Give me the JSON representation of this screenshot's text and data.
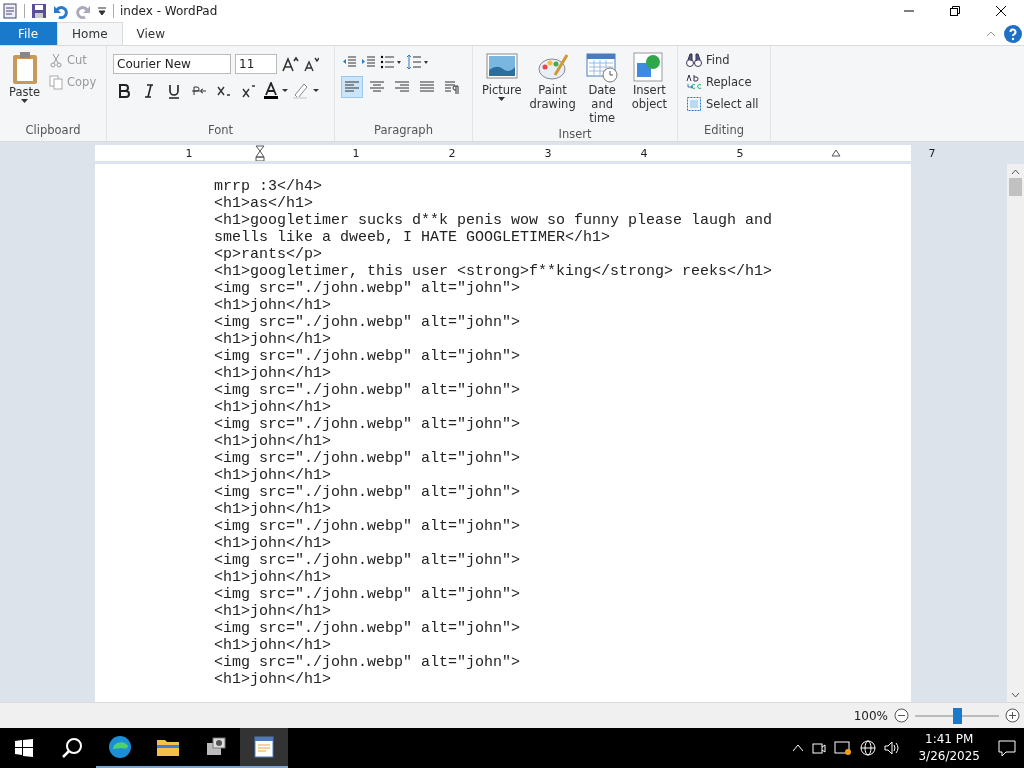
{
  "window": {
    "title": "index - WordPad"
  },
  "tabs": [
    {
      "label": "File",
      "kind": "file",
      "selected": false
    },
    {
      "label": "Home",
      "kind": "tab",
      "selected": true
    },
    {
      "label": "View",
      "kind": "tab",
      "selected": false
    }
  ],
  "ribbon": {
    "clipboard": {
      "label": "Clipboard",
      "paste": "Paste",
      "cut": {
        "label": "Cut",
        "disabled": true
      },
      "copy": {
        "label": "Copy",
        "disabled": true
      }
    },
    "font": {
      "label": "Font",
      "family": "Courier New",
      "size": "11"
    },
    "paragraph": {
      "label": "Paragraph"
    },
    "insert": {
      "label": "Insert",
      "buttons": [
        {
          "label": "Picture",
          "kind": "picture",
          "dropdown": true
        },
        {
          "label": "Paint drawing",
          "kind": "paint",
          "dropdown": false
        },
        {
          "label": "Date and time",
          "kind": "date",
          "dropdown": false
        },
        {
          "label": "Insert object",
          "kind": "object",
          "dropdown": false
        }
      ]
    },
    "editing": {
      "label": "Editing",
      "buttons": [
        {
          "label": "Find",
          "kind": "find"
        },
        {
          "label": "Replace",
          "kind": "replace"
        },
        {
          "label": "Select all",
          "kind": "selectall"
        }
      ]
    }
  },
  "ruler": [
    {
      "kind": "number",
      "text": "1"
    },
    {
      "kind": "indent"
    },
    {
      "kind": "number",
      "text": "1"
    },
    {
      "kind": "number",
      "text": "2"
    },
    {
      "kind": "number",
      "text": "3"
    },
    {
      "kind": "number",
      "text": "4"
    },
    {
      "kind": "number",
      "text": "5"
    },
    {
      "kind": "margin"
    },
    {
      "kind": "number",
      "text": "7"
    }
  ],
  "document": {
    "lines": [
      "mrrp :3</h4>",
      "<h1>as</h1>",
      "<h1>googletimer sucks d**k penis wow so funny please laugh and",
      "smells like a dweeb, I HATE GOOGLETIMER</h1>",
      "<p>rants</p>",
      "<h1>googletimer, this user <strong>f**king</strong> reeks</h1>",
      "<img src=\"./john.webp\" alt=\"john\">",
      "<h1>john</h1>",
      "<img src=\"./john.webp\" alt=\"john\">",
      "<h1>john</h1>",
      "<img src=\"./john.webp\" alt=\"john\">",
      "<h1>john</h1>",
      "<img src=\"./john.webp\" alt=\"john\">",
      "<h1>john</h1>",
      "<img src=\"./john.webp\" alt=\"john\">",
      "<h1>john</h1>",
      "<img src=\"./john.webp\" alt=\"john\">",
      "<h1>john</h1>",
      "<img src=\"./john.webp\" alt=\"john\">",
      "<h1>john</h1>",
      "<img src=\"./john.webp\" alt=\"john\">",
      "<h1>john</h1>",
      "<img src=\"./john.webp\" alt=\"john\">",
      "<h1>john</h1>",
      "<img src=\"./john.webp\" alt=\"john\">",
      "<h1>john</h1>",
      "<img src=\"./john.webp\" alt=\"john\">",
      "<h1>john</h1>",
      "<img src=\"./john.webp\" alt=\"john\">",
      "<h1>john</h1>"
    ]
  },
  "status_bar": {
    "zoom": "100%",
    "level": 0.5
  },
  "taskbar": {
    "apps": [
      {
        "kind": "edge",
        "active": false
      },
      {
        "kind": "folder",
        "active": false
      },
      {
        "kind": "tool",
        "active": false
      },
      {
        "kind": "wordpad",
        "active": true
      }
    ],
    "time": "1:41 PM",
    "date": "3/26/2025"
  }
}
